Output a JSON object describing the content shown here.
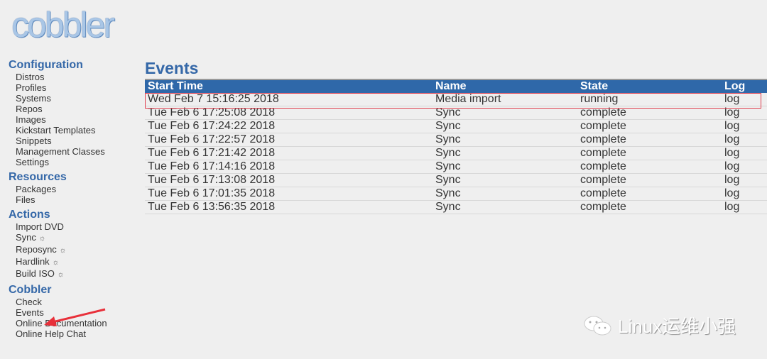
{
  "logo": "cobbler",
  "sidebar": {
    "sections": [
      {
        "title": "Configuration",
        "items": [
          "Distros",
          "Profiles",
          "Systems",
          "Repos",
          "Images",
          "Kickstart Templates",
          "Snippets",
          "Management Classes",
          "Settings"
        ]
      },
      {
        "title": "Resources",
        "items": [
          "Packages",
          "Files"
        ]
      },
      {
        "title": "Actions",
        "items": [
          "Import DVD",
          "Sync",
          "Reposync",
          "Hardlink",
          "Build ISO"
        ]
      },
      {
        "title": "Cobbler",
        "items": [
          "Check",
          "Events",
          "Online Documentation",
          "Online Help Chat"
        ]
      }
    ],
    "action_icon": "☼"
  },
  "main": {
    "title": "Events",
    "columns": [
      "Start Time",
      "Name",
      "State",
      "Log"
    ],
    "rows": [
      [
        "Wed Feb 7 15:16:25 2018",
        "Media import",
        "running",
        "log"
      ],
      [
        "Tue Feb 6 17:25:08 2018",
        "Sync",
        "complete",
        "log"
      ],
      [
        "Tue Feb 6 17:24:22 2018",
        "Sync",
        "complete",
        "log"
      ],
      [
        "Tue Feb 6 17:22:57 2018",
        "Sync",
        "complete",
        "log"
      ],
      [
        "Tue Feb 6 17:21:42 2018",
        "Sync",
        "complete",
        "log"
      ],
      [
        "Tue Feb 6 17:14:16 2018",
        "Sync",
        "complete",
        "log"
      ],
      [
        "Tue Feb 6 17:13:08 2018",
        "Sync",
        "complete",
        "log"
      ],
      [
        "Tue Feb 6 17:01:35 2018",
        "Sync",
        "complete",
        "log"
      ],
      [
        "Tue Feb 6 13:56:35 2018",
        "Sync",
        "complete",
        "log"
      ]
    ]
  },
  "watermark": "Linux运维小强",
  "colors": {
    "accent": "#3568a8",
    "header": "#2f68a9",
    "highlight": "#e04050"
  }
}
